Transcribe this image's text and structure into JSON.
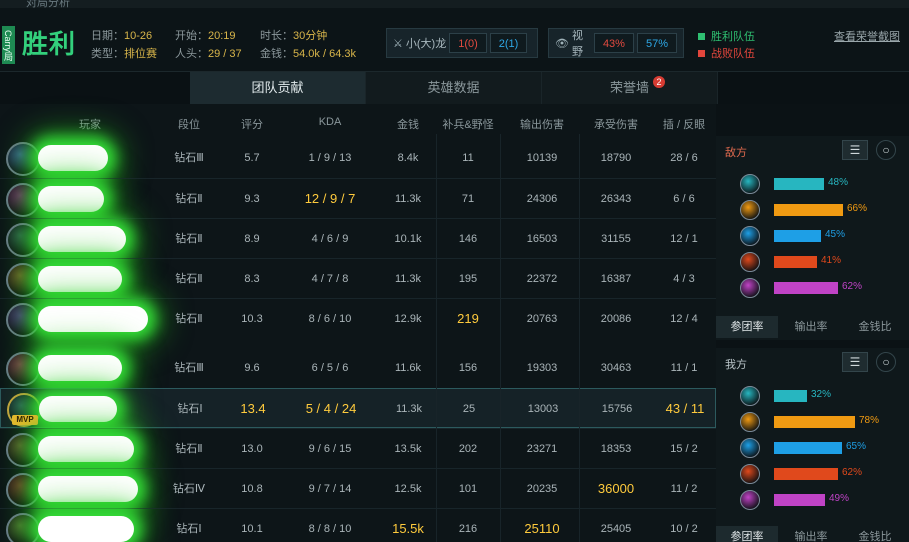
{
  "window_title": "对局分析",
  "header": {
    "vertical_tag": "Carry局",
    "result": "胜利",
    "date_label": "日期：",
    "date": "10-26",
    "type_label": "类型：",
    "type": "排位赛",
    "start_label": "开始：",
    "start": "20:19",
    "players_label": "人头：",
    "players": "29 / 37",
    "duration_label": "时长：",
    "duration": "30分钟",
    "gold_label": "金钱：",
    "gold": "54.0k / 64.3k",
    "dragon_label": "小(大)龙",
    "dragon_red": "1(0)",
    "dragon_blue": "2(1)",
    "vision_label": "视野",
    "vision_red": "43%",
    "vision_blue": "57%",
    "legend_win": "胜利队伍",
    "legend_lose": "战败队伍",
    "view_link": "查看荣誉截图"
  },
  "tabs": [
    {
      "label": "团队贡献"
    },
    {
      "label": "英雄数据"
    },
    {
      "label": "荣誉墙",
      "badge": "2"
    }
  ],
  "columns": [
    "玩家",
    "段位",
    "评分",
    "KDA",
    "金钱",
    "补兵&野怪",
    "输出伤害",
    "承受伤害",
    "插 / 反眼"
  ],
  "enemy_rows": [
    {
      "rank": "钻石Ⅲ",
      "score": "5.7",
      "kda": "1 / 9 / 13",
      "gold": "8.4k",
      "cs": "11",
      "dmg": "10139",
      "taken": "18790",
      "wards": "28 / 6"
    },
    {
      "rank": "钻石Ⅱ",
      "score": "9.3",
      "kda": "12 / 9 / 7",
      "gold": "11.3k",
      "cs": "71",
      "dmg": "24306",
      "taken": "26343",
      "wards": "6 / 6"
    },
    {
      "rank": "钻石Ⅱ",
      "score": "8.9",
      "kda": "4 / 6 / 9",
      "gold": "10.1k",
      "cs": "146",
      "dmg": "16503",
      "taken": "31155",
      "wards": "12 / 1"
    },
    {
      "rank": "钻石Ⅱ",
      "score": "8.3",
      "kda": "4 / 7 / 8",
      "gold": "11.3k",
      "cs": "195",
      "dmg": "22372",
      "taken": "16387",
      "wards": "4 / 3"
    },
    {
      "rank": "钻石Ⅱ",
      "score": "10.3",
      "kda": "8 / 6 / 10",
      "gold": "12.9k",
      "cs": "219",
      "dmg": "20763",
      "taken": "20086",
      "wards": "12 / 4"
    }
  ],
  "ally_rows": [
    {
      "rank": "钻石Ⅲ",
      "score": "9.6",
      "kda": "6 / 5 / 6",
      "gold": "11.6k",
      "cs": "156",
      "dmg": "19303",
      "taken": "30463",
      "wards": "11 / 1"
    },
    {
      "rank": "钻石Ⅰ",
      "score": "13.4",
      "kda": "5 / 4 / 24",
      "gold": "11.3k",
      "cs": "25",
      "dmg": "13003",
      "taken": "15756",
      "wards": "43 / 11",
      "mvp": "MVP"
    },
    {
      "rank": "钻石Ⅱ",
      "score": "13.0",
      "kda": "9 / 6 / 15",
      "gold": "13.5k",
      "cs": "202",
      "dmg": "23271",
      "taken": "18353",
      "wards": "15 / 2"
    },
    {
      "rank": "钻石Ⅳ",
      "score": "10.8",
      "kda": "9 / 7 / 14",
      "gold": "12.5k",
      "cs": "101",
      "dmg": "20235",
      "taken": "36000",
      "wards": "11 / 2"
    },
    {
      "rank": "钻石Ⅰ",
      "score": "10.1",
      "kda": "8 / 8 / 10",
      "gold": "15.5k",
      "cs": "216",
      "dmg": "25110",
      "taken": "25405",
      "wards": "10 / 2"
    }
  ],
  "side": {
    "enemy_title": "敌方",
    "ally_title": "我方",
    "panel_tabs": [
      "参团率",
      "输出率",
      "金钱比"
    ],
    "enemy_bars": [
      {
        "value": "48%",
        "color": "#27b6c0"
      },
      {
        "value": "66%",
        "color": "#f09a12"
      },
      {
        "value": "45%",
        "color": "#1e9fe6"
      },
      {
        "value": "41%",
        "color": "#e0491c"
      },
      {
        "value": "62%",
        "color": "#c043c6"
      }
    ],
    "ally_bars": [
      {
        "value": "32%",
        "color": "#27b6c0"
      },
      {
        "value": "78%",
        "color": "#f09a12"
      },
      {
        "value": "65%",
        "color": "#1e9fe6"
      },
      {
        "value": "62%",
        "color": "#e0491c"
      },
      {
        "value": "49%",
        "color": "#c043c6"
      }
    ]
  },
  "colors": {
    "win": "#2fbf71",
    "lose": "#e2463c",
    "highlight": "#ffcb3d"
  }
}
